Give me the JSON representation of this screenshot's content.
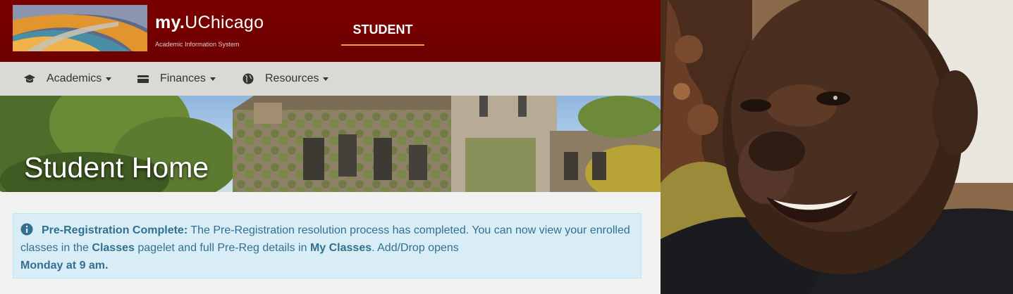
{
  "header": {
    "brand_prefix": "my.",
    "brand_name": "UChicago",
    "brand_subtitle": "Academic Information System",
    "nav_tab": "STUDENT",
    "accent_color": "#e8a23c",
    "header_color": "#720000"
  },
  "menu": {
    "items": [
      {
        "label": "Academics",
        "icon": "graduation-cap-icon"
      },
      {
        "label": "Finances",
        "icon": "credit-card-icon"
      },
      {
        "label": "Resources",
        "icon": "globe-icon"
      }
    ]
  },
  "hero": {
    "title": "Student Home"
  },
  "alert": {
    "icon": "info-circle-icon",
    "heading": "Pre-Registration Complete:",
    "text_1": "The Pre-Registration resolution process has completed. You can now view your enrolled classes in the",
    "link_classes": "Classes",
    "text_2": "pagelet and full Pre-Reg details in",
    "link_my_classes": "My Classes",
    "text_3": ". Add/Drop opens",
    "emphasis": "Monday at 9 am.",
    "bg_color": "#d9edf7",
    "text_color": "#31708f"
  },
  "photo": {
    "subject": "smiling-man-photo"
  }
}
